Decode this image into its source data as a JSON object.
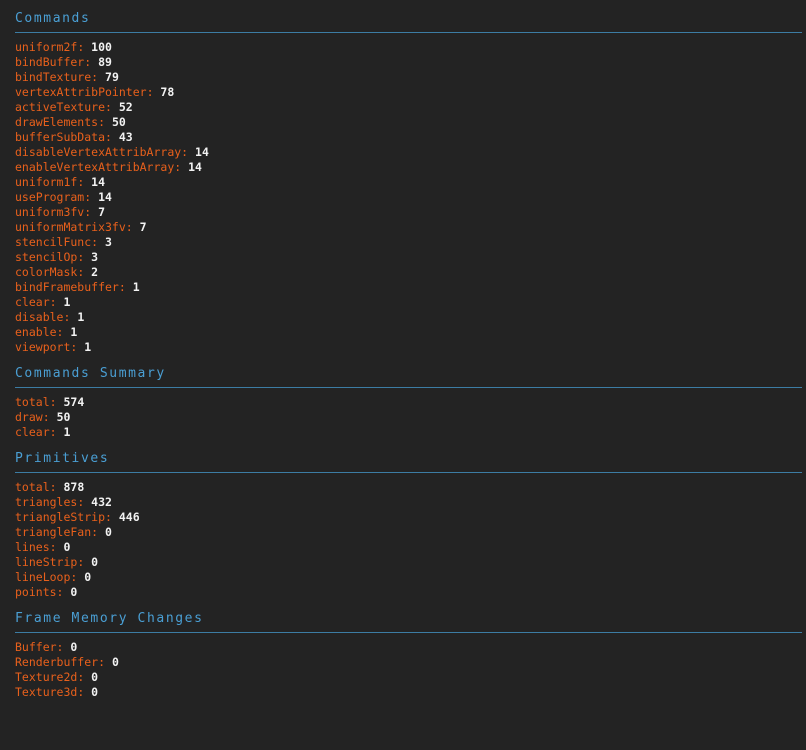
{
  "colors": {
    "background": "#232323",
    "header_text": "#4a9fd4",
    "header_rule": "#3c7ca3",
    "key_text": "#e8601c",
    "value_text": "#f2f2f2"
  },
  "sections": [
    {
      "title": "Commands",
      "rows": [
        {
          "key": "uniform2f",
          "value": "100"
        },
        {
          "key": "bindBuffer",
          "value": "89"
        },
        {
          "key": "bindTexture",
          "value": "79"
        },
        {
          "key": "vertexAttribPointer",
          "value": "78"
        },
        {
          "key": "activeTexture",
          "value": "52"
        },
        {
          "key": "drawElements",
          "value": "50"
        },
        {
          "key": "bufferSubData",
          "value": "43"
        },
        {
          "key": "disableVertexAttribArray",
          "value": "14"
        },
        {
          "key": "enableVertexAttribArray",
          "value": "14"
        },
        {
          "key": "uniform1f",
          "value": "14"
        },
        {
          "key": "useProgram",
          "value": "14"
        },
        {
          "key": "uniform3fv",
          "value": "7"
        },
        {
          "key": "uniformMatrix3fv",
          "value": "7"
        },
        {
          "key": "stencilFunc",
          "value": "3"
        },
        {
          "key": "stencilOp",
          "value": "3"
        },
        {
          "key": "colorMask",
          "value": "2"
        },
        {
          "key": "bindFramebuffer",
          "value": "1"
        },
        {
          "key": "clear",
          "value": "1"
        },
        {
          "key": "disable",
          "value": "1"
        },
        {
          "key": "enable",
          "value": "1"
        },
        {
          "key": "viewport",
          "value": "1"
        }
      ]
    },
    {
      "title": "Commands Summary",
      "rows": [
        {
          "key": "total",
          "value": "574"
        },
        {
          "key": "draw",
          "value": "50"
        },
        {
          "key": "clear",
          "value": "1"
        }
      ]
    },
    {
      "title": "Primitives",
      "rows": [
        {
          "key": "total",
          "value": "878"
        },
        {
          "key": "triangles",
          "value": "432"
        },
        {
          "key": "triangleStrip",
          "value": "446"
        },
        {
          "key": "triangleFan",
          "value": "0"
        },
        {
          "key": "lines",
          "value": "0"
        },
        {
          "key": "lineStrip",
          "value": "0"
        },
        {
          "key": "lineLoop",
          "value": "0"
        },
        {
          "key": "points",
          "value": "0"
        }
      ]
    },
    {
      "title": "Frame Memory Changes",
      "rows": [
        {
          "key": "Buffer",
          "value": "0"
        },
        {
          "key": "Renderbuffer",
          "value": "0"
        },
        {
          "key": "Texture2d",
          "value": "0"
        },
        {
          "key": "Texture3d",
          "value": "0"
        }
      ]
    }
  ],
  "separator": ": "
}
